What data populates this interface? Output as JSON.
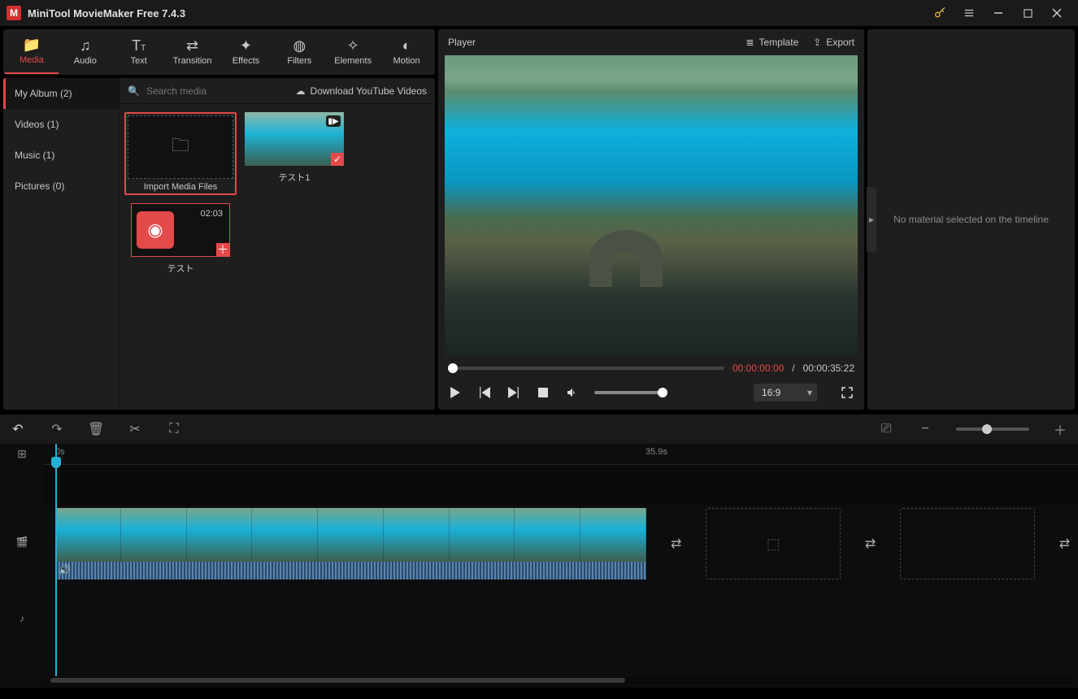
{
  "title": "MiniTool MovieMaker Free 7.4.3",
  "tabs": [
    {
      "label": "Media"
    },
    {
      "label": "Audio"
    },
    {
      "label": "Text"
    },
    {
      "label": "Transition"
    },
    {
      "label": "Effects"
    },
    {
      "label": "Filters"
    },
    {
      "label": "Elements"
    },
    {
      "label": "Motion"
    }
  ],
  "categories": [
    {
      "label": "My Album (2)"
    },
    {
      "label": "Videos (1)"
    },
    {
      "label": "Music (1)"
    },
    {
      "label": "Pictures (0)"
    }
  ],
  "searchPlaceholder": "Search media",
  "downloadLabel": "Download YouTube Videos",
  "importLabel": "Import Media Files",
  "clip1": "テスト1",
  "clip2": "テスト",
  "clip2Dur": "02:03",
  "player": {
    "header": "Player",
    "template": "Template",
    "export": "Export",
    "current": "00:00:00:00",
    "sep": "/",
    "total": "00:00:35:22",
    "aspect": "16:9"
  },
  "inspector": {
    "empty": "No material selected on the timeline"
  },
  "timeline": {
    "t0": "0s",
    "t1": "35.9s"
  }
}
